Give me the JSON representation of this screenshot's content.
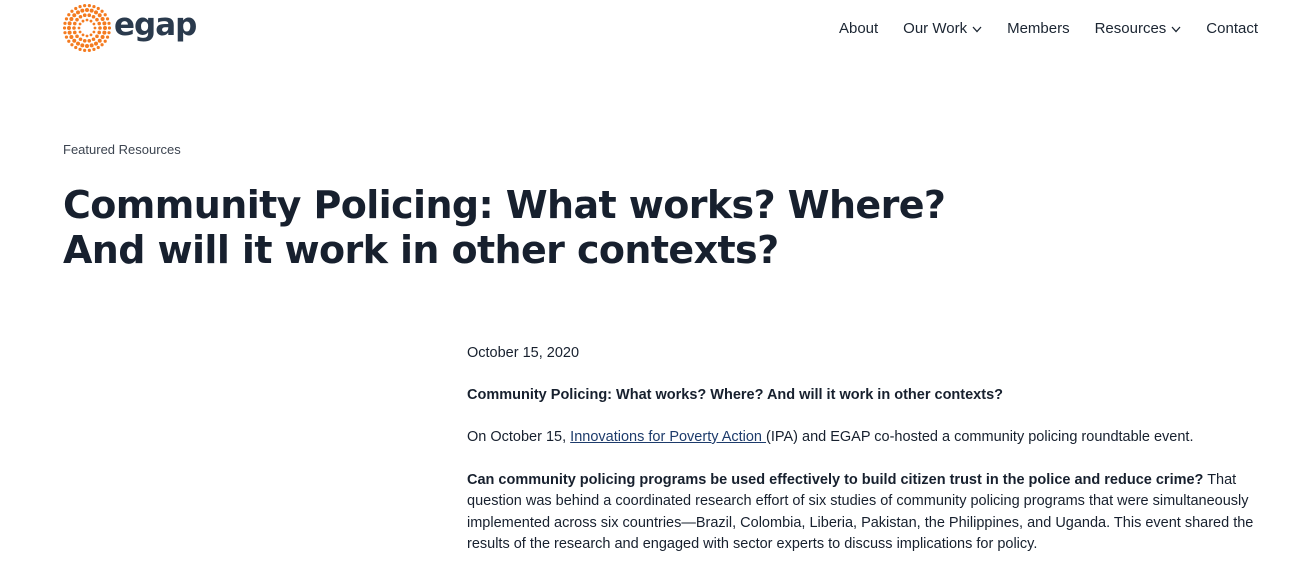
{
  "header": {
    "logo_text": "egap",
    "logo_color": "#f47b20",
    "nav": [
      {
        "label": "About",
        "has_dropdown": false
      },
      {
        "label": "Our Work",
        "has_dropdown": true
      },
      {
        "label": "Members",
        "has_dropdown": false
      },
      {
        "label": "Resources",
        "has_dropdown": true
      },
      {
        "label": "Contact",
        "has_dropdown": false
      }
    ]
  },
  "article": {
    "eyebrow": "Featured Resources",
    "title_line1": "Community Policing: What works? Where?",
    "title_line2": "And will it work in other contexts?",
    "date": "October 15, 2020",
    "subheading": "Community Policing: What works? Where? And will it work in other contexts?",
    "intro": {
      "before_link": "On October 15, ",
      "link_text": "Innovations for Poverty Action ",
      "after_link": "(IPA) and EGAP co-hosted a community policing roundtable event."
    },
    "body": {
      "bold_lead": "Can community policing programs be used effectively to build citizen trust in the police and reduce crime?",
      "rest": " That question was behind a coordinated research effort of six studies of community policing programs that were simultaneously implemented across six countries—Brazil, Colombia, Liberia, Pakistan, the Philippines, and Uganda. This event shared the results of the research and engaged with sector experts to discuss implications for policy."
    }
  }
}
